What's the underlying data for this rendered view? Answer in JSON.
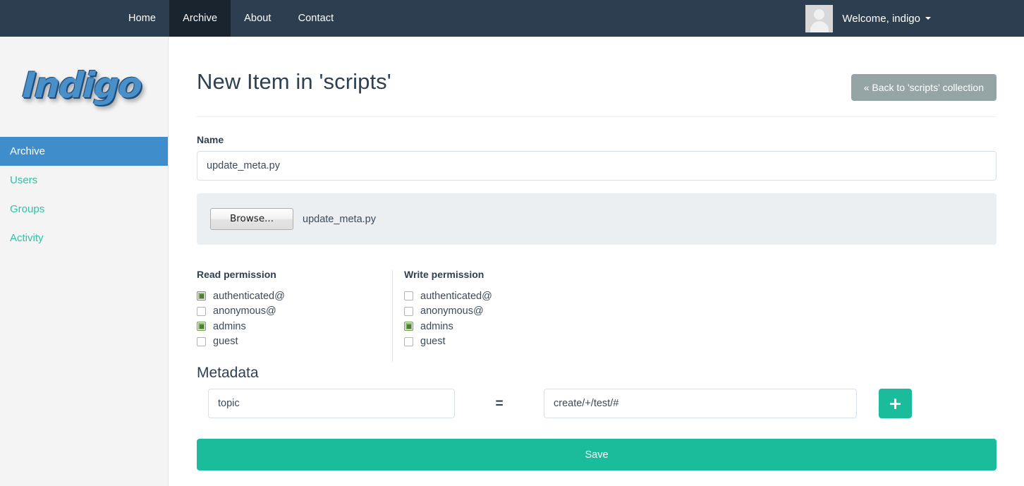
{
  "navbar": {
    "items": [
      {
        "label": "Home",
        "active": false
      },
      {
        "label": "Archive",
        "active": true
      },
      {
        "label": "About",
        "active": false
      },
      {
        "label": "Contact",
        "active": false
      }
    ],
    "user": {
      "welcome_text": "Welcome, indigo",
      "avatar_icon": "user-avatar-placeholder-icon",
      "caret_icon": "caret-down-icon"
    }
  },
  "sidebar": {
    "logo_text": "Indigo",
    "items": [
      {
        "label": "Archive",
        "active": true
      },
      {
        "label": "Users",
        "active": false
      },
      {
        "label": "Groups",
        "active": false
      },
      {
        "label": "Activity",
        "active": false
      }
    ]
  },
  "main": {
    "page_title": "New Item in 'scripts'",
    "back_button_label": "« Back to 'scripts' collection",
    "name": {
      "label": "Name",
      "value": "update_meta.py",
      "placeholder": ""
    },
    "file_upload": {
      "browse_label": "Browse...",
      "file_name": "update_meta.py"
    },
    "read_permission": {
      "title": "Read permission",
      "options": [
        {
          "label": "authenticated@",
          "checked": true
        },
        {
          "label": "anonymous@",
          "checked": false
        },
        {
          "label": "admins",
          "checked": true
        },
        {
          "label": "guest",
          "checked": false
        }
      ]
    },
    "write_permission": {
      "title": "Write permission",
      "options": [
        {
          "label": "authenticated@",
          "checked": false
        },
        {
          "label": "anonymous@",
          "checked": false
        },
        {
          "label": "admins",
          "checked": true
        },
        {
          "label": "guest",
          "checked": false
        }
      ]
    },
    "metadata": {
      "title": "Metadata",
      "key_value": "topic",
      "key_placeholder": "",
      "equals_sign": "=",
      "value_value": "create/+/test/#",
      "value_placeholder": "",
      "add_button_icon": "plus-icon"
    },
    "save_button_label": "Save"
  },
  "colors": {
    "navbar_bg": "#2c3e50",
    "navbar_active": "#1a242f",
    "sidebar_bg": "#f4f4f4",
    "sidebar_active": "#3f8dcb",
    "sidebar_link": "#2bc4a4",
    "accent_teal": "#1abc9c",
    "back_button": "#95a5a6",
    "checkbox_checked": "#8cc06a",
    "text_dark": "#2f4052"
  }
}
